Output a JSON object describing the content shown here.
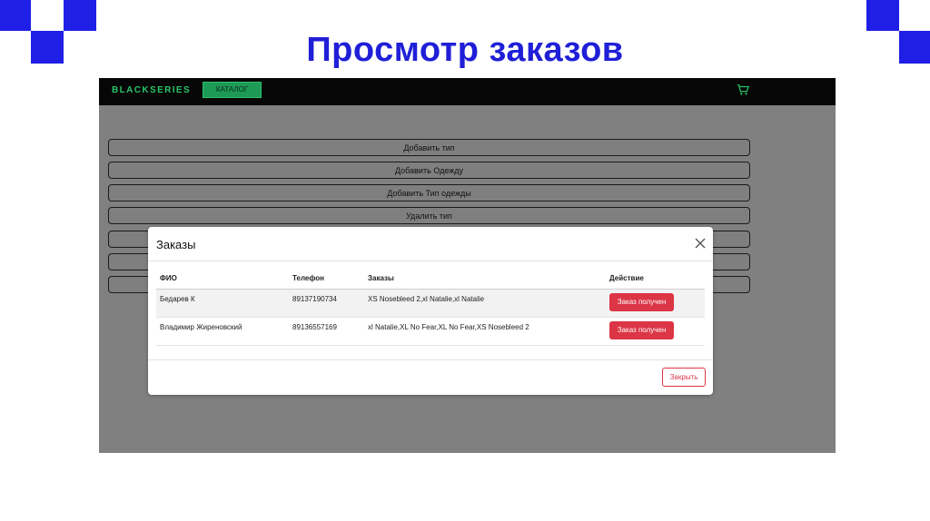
{
  "slide": {
    "title": "Просмотр заказов"
  },
  "navbar": {
    "brand": "BLACKSERIES",
    "catalog_label": "КАТАЛОГ",
    "cart_icon": "cart-icon"
  },
  "admin_buttons": [
    "Добавить тип",
    "Добавить Одежду",
    "Добавить Тип одежды",
    "Удалить тип",
    "",
    "",
    ""
  ],
  "modal": {
    "title": "Заказы",
    "close_icon": "close-icon",
    "columns": [
      "ФИО",
      "Телефон",
      "Заказы",
      "Действие"
    ],
    "rows": [
      {
        "name": "Бедарев К",
        "phone": "89137190734",
        "orders": "XS Nosebleed 2,xl Natalie,xl Natalie",
        "action": "Заказ получен"
      },
      {
        "name": "Владимир Жиреновский",
        "phone": "89136557169",
        "orders": "xl Natalie,XL No Fear,XL No Fear,XS Nosebleed 2",
        "action": "Заказ получен"
      }
    ],
    "footer_close": "Закрыть"
  },
  "colors": {
    "accent_blue": "#1f1fe6",
    "brand_green": "#29c46a",
    "danger": "#dc3545"
  }
}
